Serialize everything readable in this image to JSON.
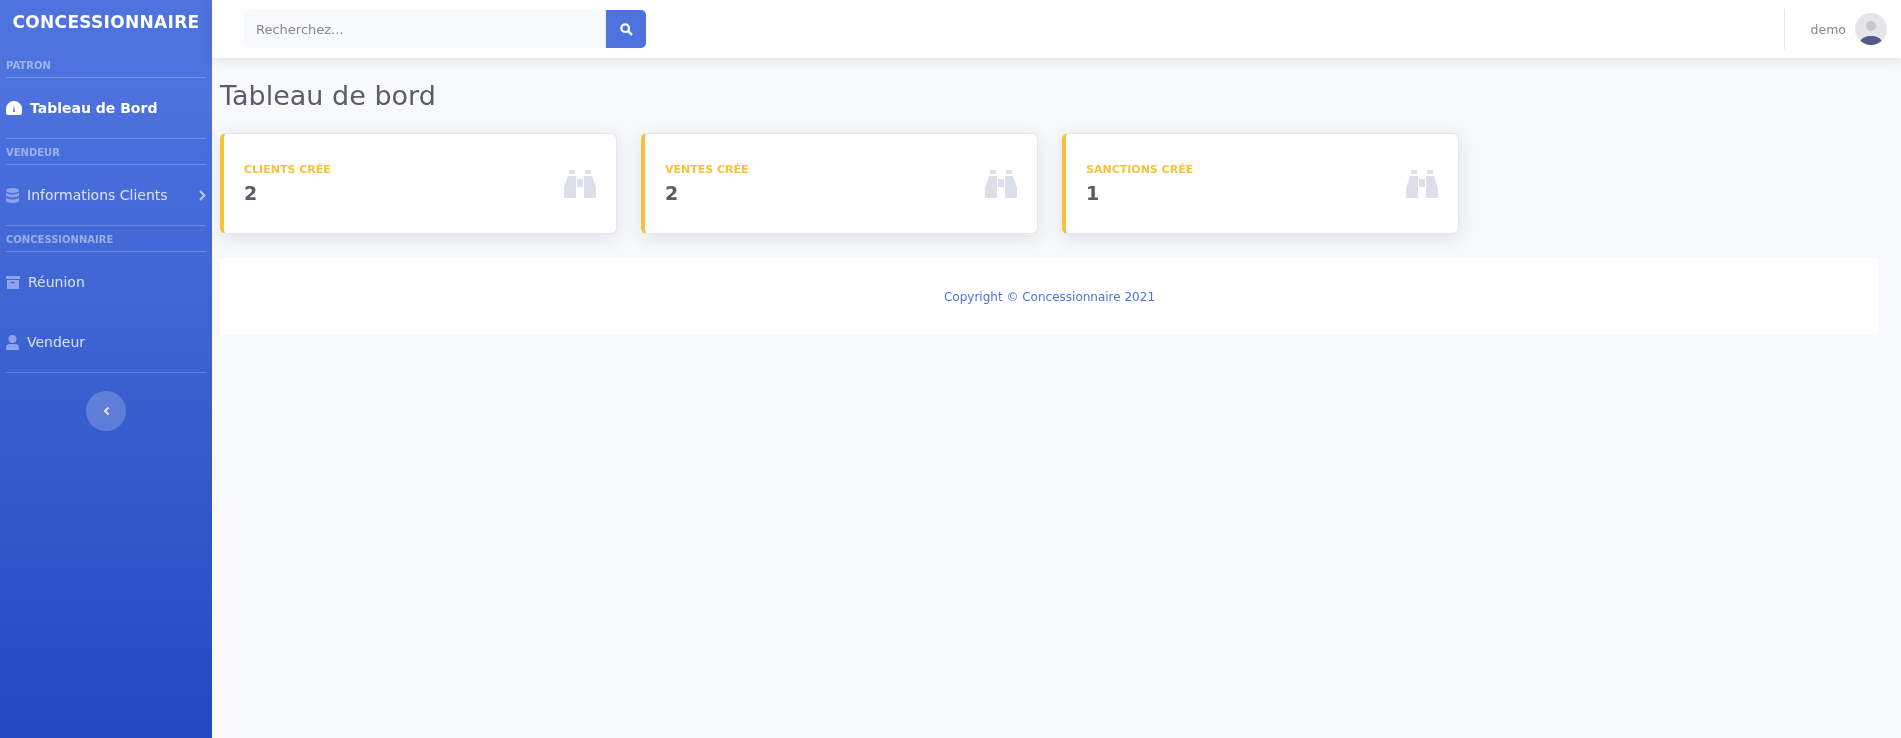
{
  "sidebar": {
    "brand": "CONCESSIONNAIRE",
    "sections": [
      {
        "heading": "PATRON",
        "items": [
          {
            "label": "Tableau de Bord",
            "kind": "gauge",
            "selected": true,
            "submenu": false
          }
        ]
      },
      {
        "heading": "VENDEUR",
        "items": [
          {
            "label": "Informations Clients",
            "kind": "database",
            "selected": false,
            "submenu": true
          }
        ]
      },
      {
        "heading": "CONCESSIONNAIRE",
        "items": [
          {
            "label": "Réunion",
            "kind": "archive",
            "selected": false,
            "submenu": false
          },
          {
            "label": "Vendeur",
            "kind": "user",
            "selected": false,
            "submenu": false
          }
        ]
      }
    ]
  },
  "topbar": {
    "search": {
      "placeholder": "Recherchez..."
    },
    "user": {
      "name": "demo"
    }
  },
  "page": {
    "title": "Tableau de bord",
    "cards": [
      {
        "label": "CLIENTS CRÉE",
        "value": "2"
      },
      {
        "label": "VENTES CRÉE",
        "value": "2"
      },
      {
        "label": "SANCTIONS CRÉE",
        "value": "1"
      }
    ]
  },
  "footer": {
    "text": "Copyright © Concessionnaire 2021"
  }
}
